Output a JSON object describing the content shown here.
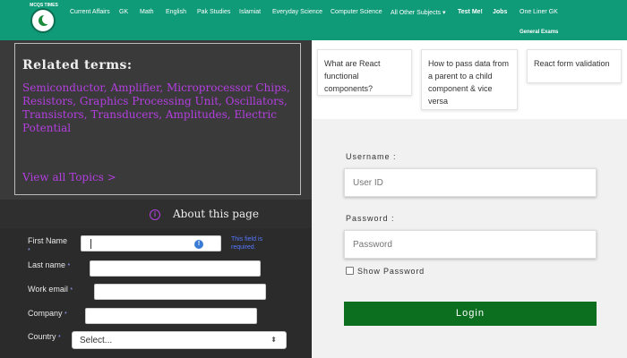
{
  "header": {
    "logo_text": "MCQS TIMES",
    "nav": [
      {
        "label": "Current Affairs"
      },
      {
        "label": "GK"
      },
      {
        "label": "Math"
      },
      {
        "label": "English"
      },
      {
        "label": "Pak Studies"
      },
      {
        "label": "Islamiat"
      },
      {
        "label": "Everyday Science"
      },
      {
        "label": "Computer Science"
      },
      {
        "label": "All Other Subjects ▾"
      },
      {
        "label": "Test Me!"
      },
      {
        "label": "Jobs"
      },
      {
        "label": "One Liner GK"
      }
    ],
    "sub_nav": "General Exams",
    "colors": {
      "nav_bg": "#0f9a78"
    }
  },
  "related_terms": {
    "title": "Related terms:",
    "terms_text": "Semiconductor, Amplifier, Microprocessor Chips, Resistors, Graphics Processing Unit, Oscillators, Transistors, Transducers, Amplitudes, Electric Potential",
    "view_all": "View all Topics  >",
    "accent_color": "#b33fe0"
  },
  "about": {
    "icon": "info-icon",
    "label": "About this page"
  },
  "lead_form": {
    "first_name_label": "First Name",
    "last_name_label": "Last name",
    "work_email_label": "Work email",
    "company_label": "Company",
    "country_label": "Country",
    "required_star": "*",
    "hint": "This field is required.",
    "country_value": "Select...",
    "first_name_value": ""
  },
  "related_articles": [
    {
      "title": "What are React functional components?"
    },
    {
      "title": "How to pass data from a parent to a child component & vice versa"
    },
    {
      "title": "React form validation"
    }
  ],
  "login": {
    "username_label": "Username :",
    "username_placeholder": "User ID",
    "password_label": "Password :",
    "password_placeholder": "Password",
    "show_password_label": "Show Password",
    "login_button": "Login",
    "button_color": "#0c6e1f"
  }
}
